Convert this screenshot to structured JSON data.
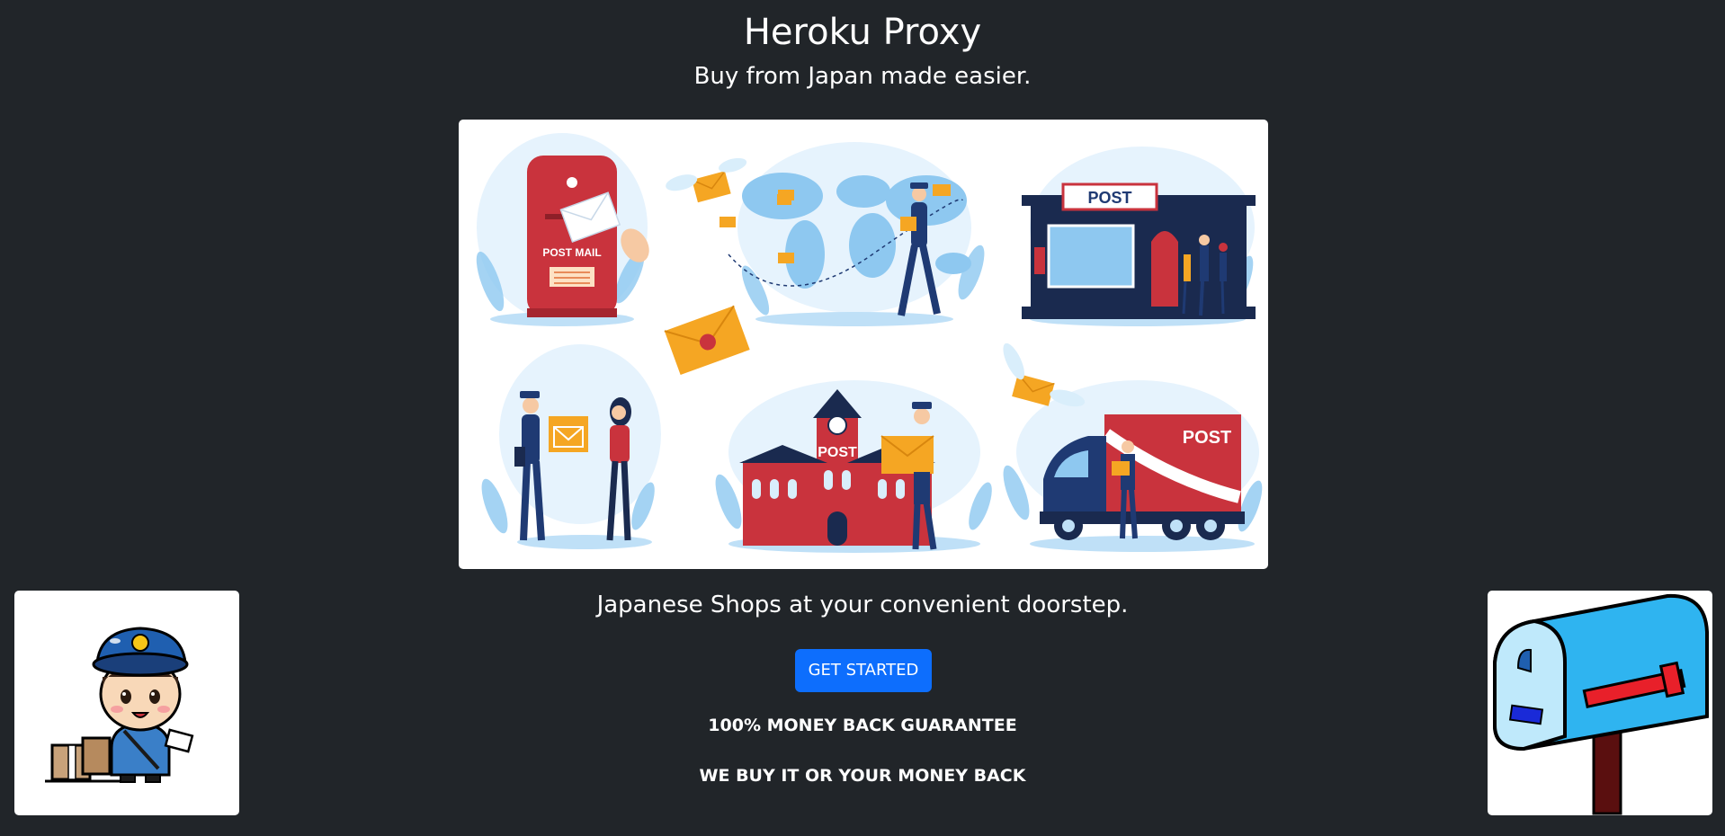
{
  "header": {
    "title": "Heroku Proxy",
    "subtitle": "Buy from Japan made easier."
  },
  "hero": {
    "image_name": "postal-service-illustration",
    "labels": {
      "mailbox": "POST MAIL",
      "office_sign": "POST",
      "building_sign": "POST",
      "truck_sign": "POST"
    }
  },
  "main": {
    "tagline": "Japanese Shops at your convenient doorstep.",
    "cta_label": "GET STARTED",
    "guarantee_line_1": "100% MONEY BACK GUARANTEE",
    "guarantee_line_2": "WE BUY IT OR YOUR MONEY BACK"
  },
  "side_images": {
    "left": "mail-carrier-mascot",
    "right": "blue-mailbox"
  },
  "colors": {
    "background": "#212529",
    "accent": "#0d6efd",
    "postal_red": "#c9333d",
    "postal_navy": "#1f3a73",
    "envelope_orange": "#f5a623"
  }
}
